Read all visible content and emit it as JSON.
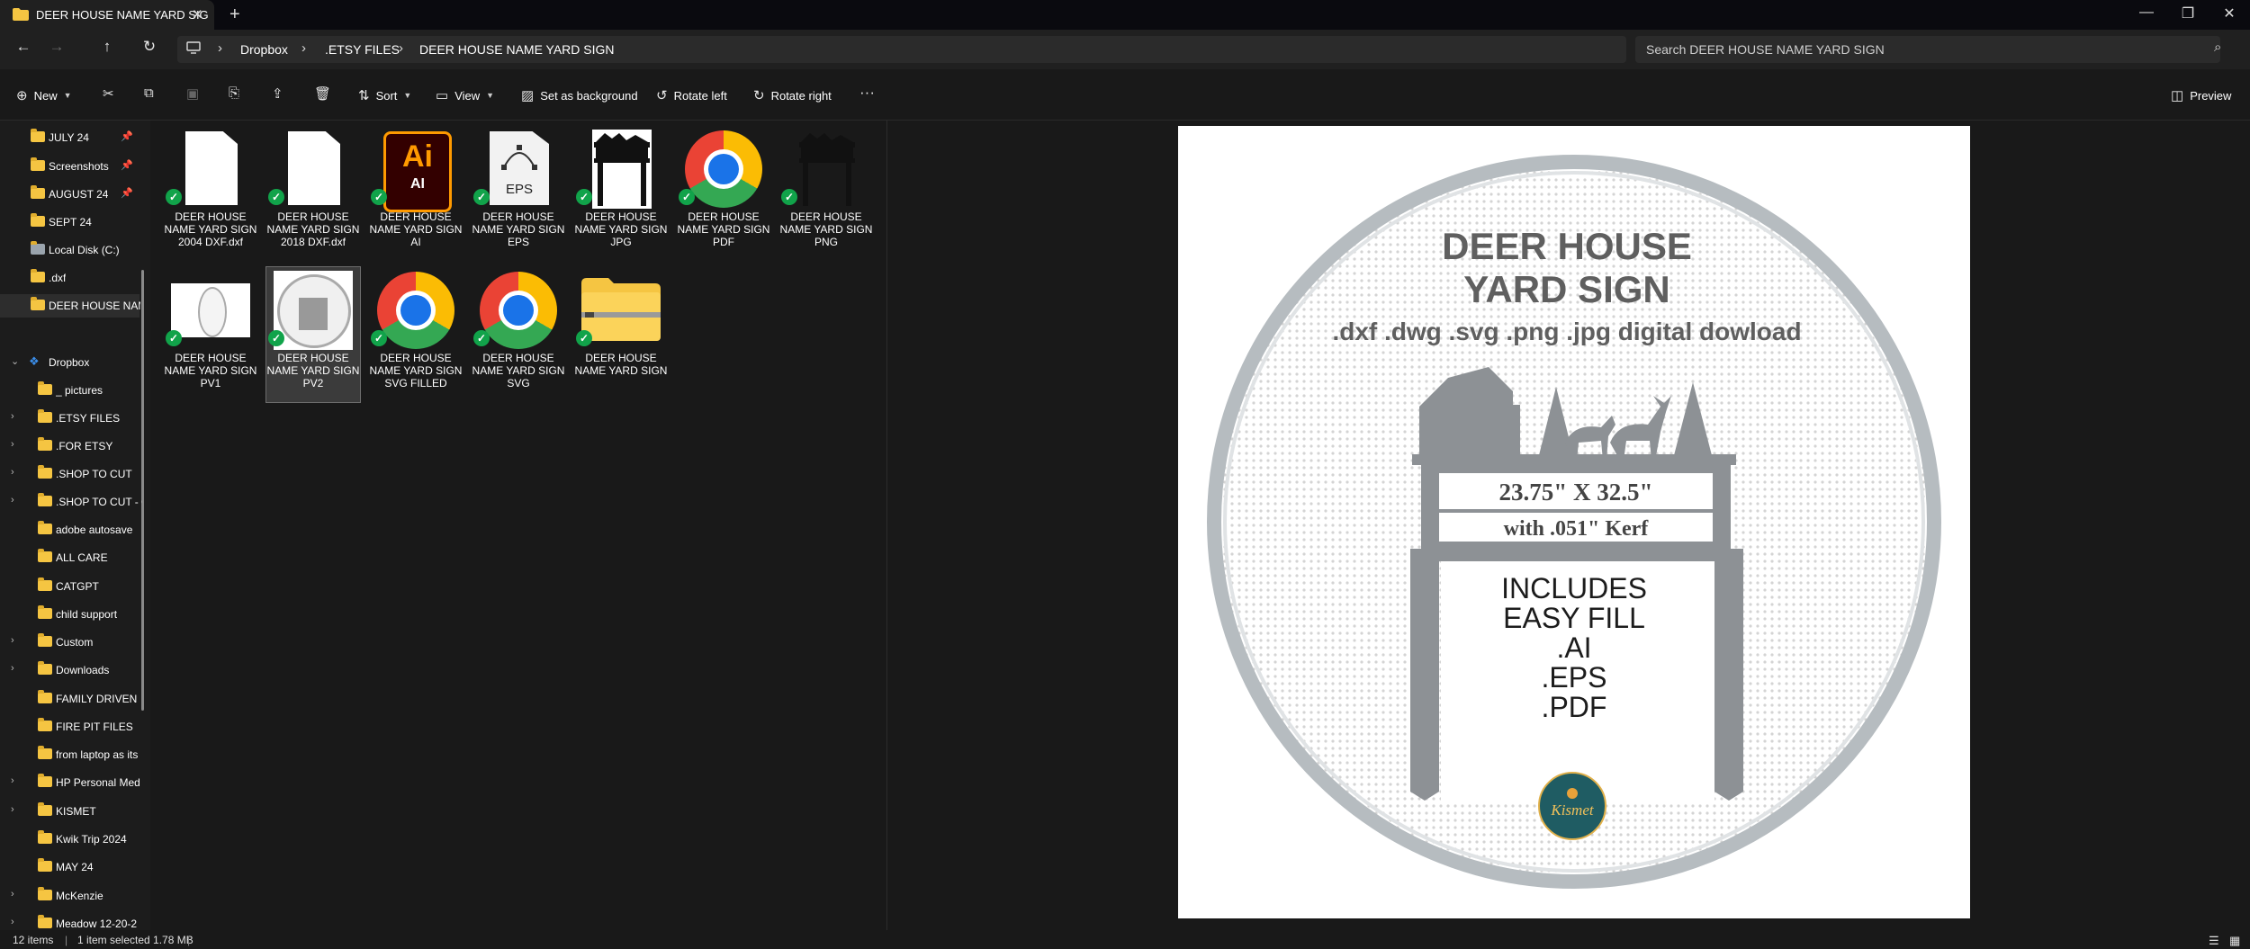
{
  "window": {
    "tab_title": "DEER HOUSE NAME YARD SIG",
    "tab_close_icon": "close-icon",
    "new_tab_label": "+",
    "minimize": "—",
    "maximize": "❐",
    "close": "✕"
  },
  "breadcrumb": [
    "Dropbox",
    ".ETSY FILES",
    "DEER HOUSE NAME YARD SIGN"
  ],
  "search": {
    "placeholder": "Search DEER HOUSE NAME YARD SIGN"
  },
  "toolbar": {
    "new_label": "New",
    "sort_label": "Sort",
    "view_label": "View",
    "set_background_label": "Set as background",
    "rotate_left_label": "Rotate left",
    "rotate_right_label": "Rotate right",
    "more_label": "···",
    "preview_label": "Preview"
  },
  "sidebar": {
    "items": [
      {
        "label": "JULY 24",
        "pinned": true
      },
      {
        "label": "Screenshots",
        "pinned": true
      },
      {
        "label": "AUGUST 24",
        "pinned": true
      },
      {
        "label": "SEPT 24",
        "pinned": false
      },
      {
        "label": "Local Disk (C:)",
        "pinned": false
      },
      {
        "label": ".dxf",
        "pinned": false
      },
      {
        "label": "DEER HOUSE NAM",
        "pinned": false,
        "selected": true
      },
      {
        "label": "Dropbox",
        "expanded": true
      },
      {
        "label": "_ pictures"
      },
      {
        "label": ".ETSY FILES"
      },
      {
        "label": ".FOR ETSY"
      },
      {
        "label": ".SHOP TO CUT"
      },
      {
        "label": ".SHOP TO CUT - C"
      },
      {
        "label": "adobe autosave"
      },
      {
        "label": "ALL CARE"
      },
      {
        "label": "CATGPT"
      },
      {
        "label": "child support"
      },
      {
        "label": "Custom"
      },
      {
        "label": "Downloads"
      },
      {
        "label": "FAMILY DRIVEN"
      },
      {
        "label": "FIRE PIT FILES"
      },
      {
        "label": "from laptop as its"
      },
      {
        "label": "HP Personal Med"
      },
      {
        "label": "KISMET"
      },
      {
        "label": "Kwik Trip 2024"
      },
      {
        "label": "MAY 24"
      },
      {
        "label": "McKenzie"
      },
      {
        "label": "Meadow 12-20-2"
      }
    ]
  },
  "files": [
    {
      "name": "DEER HOUSE NAME YARD SIGN 2004 DXF.dxf",
      "type": "doc"
    },
    {
      "name": "DEER HOUSE NAME YARD SIGN 2018 DXF.dxf",
      "type": "doc"
    },
    {
      "name": "DEER HOUSE NAME YARD SIGN AI",
      "type": "ai",
      "icon_text": "Ai",
      "icon_sub": "AI"
    },
    {
      "name": "DEER HOUSE NAME YARD SIGN EPS",
      "type": "eps",
      "icon_text": "EPS"
    },
    {
      "name": "DEER HOUSE NAME YARD SIGN JPG",
      "type": "sign-jpg"
    },
    {
      "name": "DEER HOUSE NAME YARD SIGN PDF",
      "type": "chrome"
    },
    {
      "name": "DEER HOUSE NAME YARD SIGN PNG",
      "type": "sign-png"
    },
    {
      "name": "DEER HOUSE NAME YARD SIGN PV1",
      "type": "pv1"
    },
    {
      "name": "DEER HOUSE NAME YARD SIGN PV2",
      "type": "pv2",
      "selected": true
    },
    {
      "name": "DEER HOUSE NAME YARD SIGN SVG FILLED",
      "type": "chrome"
    },
    {
      "name": "DEER HOUSE NAME YARD SIGN SVG",
      "type": "chrome"
    },
    {
      "name": "DEER HOUSE NAME YARD SIGN",
      "type": "zip"
    }
  ],
  "preview": {
    "title_line1": "DEER HOUSE",
    "title_line2": "YARD SIGN",
    "formats": ".dxf .dwg .svg .png .jpg digital dowload",
    "size_line1": "23.75\" X 32.5\"",
    "size_line2": "with .051\" Kerf",
    "includes": [
      "INCLUDES",
      "EASY FILL",
      ".AI",
      ".EPS",
      ".PDF"
    ],
    "logo_text": "Kismet"
  },
  "status": {
    "items_count": "12 items",
    "selection": "1 item selected  1.78 MB"
  }
}
